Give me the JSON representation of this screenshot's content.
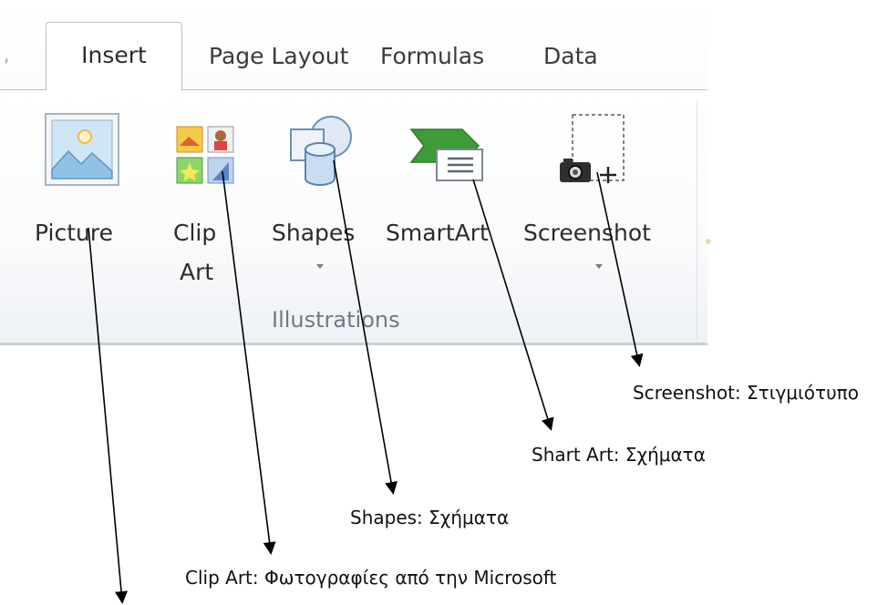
{
  "tabs": {
    "active": "Insert",
    "others": [
      "Page Layout",
      "Formulas",
      "Data"
    ]
  },
  "ribbon": {
    "commands": [
      {
        "id": "picture",
        "label": "Picture",
        "icon": "picture-icon"
      },
      {
        "id": "clipart",
        "label_line1": "Clip",
        "label_line2": "Art",
        "icon": "clip-art-icon"
      },
      {
        "id": "shapes",
        "label": "Shapes",
        "icon": "shapes-icon",
        "has_dropdown": true
      },
      {
        "id": "smartart",
        "label": "SmartArt",
        "icon": "smartart-icon"
      },
      {
        "id": "screenshot",
        "label": "Screenshot",
        "icon": "screenshot-icon",
        "has_dropdown": true
      }
    ],
    "group_label": "Illustrations"
  },
  "annotations": {
    "screenshot": "Screenshot: Στιγμιότυπο",
    "smartart": "Shart Art: Σχήματα",
    "shapes": "Shapes: Σχήματα",
    "clipart": "Clip Art: Φωτογραφίες από την Microsoft"
  },
  "colors": {
    "ribbon_border": "#b6bfca",
    "group_label": "#6f7a86",
    "smartart_green": "#3f9a3a"
  }
}
